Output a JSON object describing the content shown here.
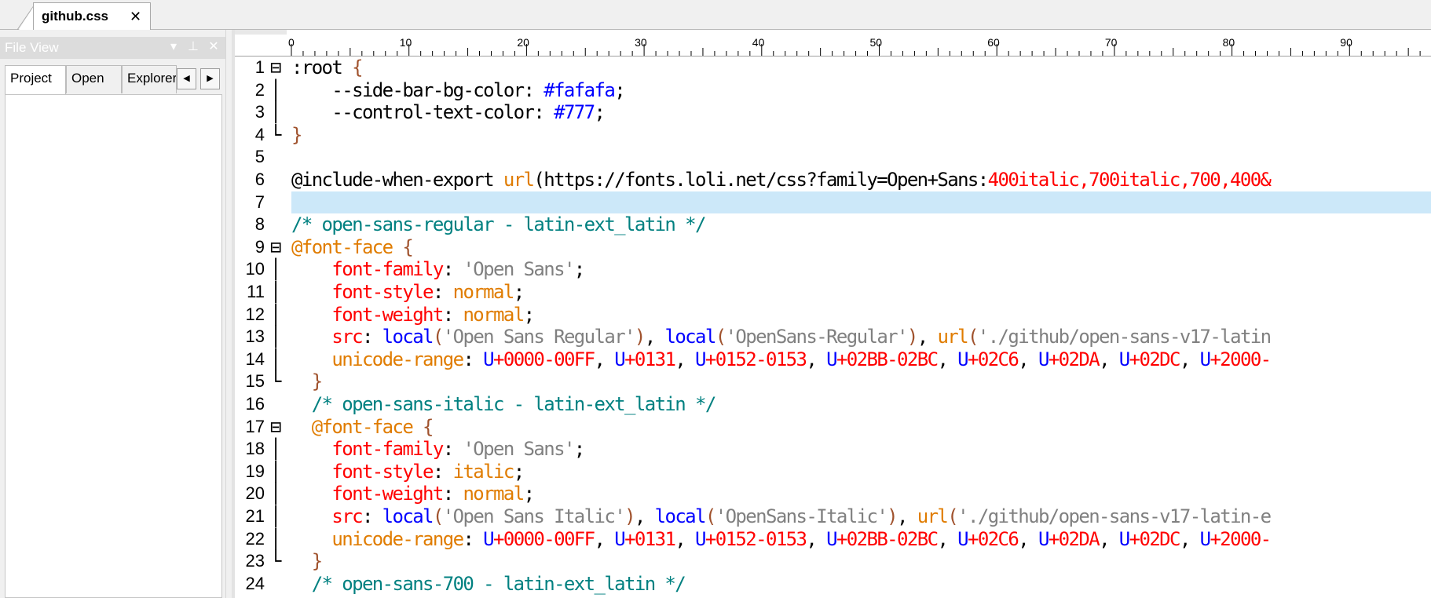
{
  "tab": {
    "title": "github.css",
    "close": "✕"
  },
  "fileview": {
    "title": "File View",
    "buttons": {
      "dropdown": "▾",
      "pin": "⊥",
      "close": "✕"
    },
    "tabs": [
      {
        "label": "Project"
      },
      {
        "label": "Open"
      },
      {
        "label": "Explorer"
      }
    ],
    "arrows": {
      "left": "◀",
      "right": "▶"
    }
  },
  "ruler": {
    "labels": [
      "0",
      "10",
      "20",
      "30",
      "40",
      "50",
      "60",
      "70",
      "80",
      "90"
    ]
  },
  "editor": {
    "current_line": 7,
    "lines": [
      {
        "n": "1",
        "fold": "⊟",
        "tokens": [
          [
            "t-plain",
            ":root "
          ],
          [
            "t-brace",
            "{"
          ]
        ]
      },
      {
        "n": "2",
        "fold": "│",
        "tokens": [
          [
            "t-var",
            "    --side-bar-bg-color: "
          ],
          [
            "t-blue",
            "#fafafa"
          ],
          [
            "t-plain",
            ";"
          ]
        ]
      },
      {
        "n": "3",
        "fold": "│",
        "tokens": [
          [
            "t-var",
            "    --control-text-color: "
          ],
          [
            "t-blue",
            "#777"
          ],
          [
            "t-plain",
            ";"
          ]
        ]
      },
      {
        "n": "4",
        "fold": "└",
        "tokens": [
          [
            "t-brace",
            "}"
          ]
        ]
      },
      {
        "n": "5",
        "fold": "",
        "tokens": []
      },
      {
        "n": "6",
        "fold": "",
        "tokens": [
          [
            "t-plain",
            "@include-when-export "
          ],
          [
            "t-orange",
            "url"
          ],
          [
            "t-plain",
            "(https://fonts.loli.net/css?family=Open+Sans:"
          ],
          [
            "t-red",
            "400italic,700italic,700,400&"
          ]
        ]
      },
      {
        "n": "7",
        "fold": "",
        "tokens": []
      },
      {
        "n": "8",
        "fold": "",
        "tokens": [
          [
            "t-comment",
            "/* open-sans-regular - latin-ext_latin */"
          ]
        ]
      },
      {
        "n": "9",
        "fold": "⊟",
        "tokens": [
          [
            "t-orange",
            "@font-face "
          ],
          [
            "t-brace",
            "{"
          ]
        ]
      },
      {
        "n": "10",
        "fold": "│",
        "tokens": [
          [
            "t-red",
            "    font-family"
          ],
          [
            "t-plain",
            ": "
          ],
          [
            "t-gray",
            "'Open Sans'"
          ],
          [
            "t-plain",
            ";"
          ]
        ]
      },
      {
        "n": "11",
        "fold": "│",
        "tokens": [
          [
            "t-red",
            "    font-style"
          ],
          [
            "t-plain",
            ": "
          ],
          [
            "t-orange",
            "normal"
          ],
          [
            "t-plain",
            ";"
          ]
        ]
      },
      {
        "n": "12",
        "fold": "│",
        "tokens": [
          [
            "t-red",
            "    font-weight"
          ],
          [
            "t-plain",
            ": "
          ],
          [
            "t-orange",
            "normal"
          ],
          [
            "t-plain",
            ";"
          ]
        ]
      },
      {
        "n": "13",
        "fold": "│",
        "tokens": [
          [
            "t-red",
            "    src"
          ],
          [
            "t-plain",
            ": "
          ],
          [
            "t-blue",
            "local"
          ],
          [
            "t-pun",
            "("
          ],
          [
            "t-gray",
            "'Open Sans Regular'"
          ],
          [
            "t-pun",
            ")"
          ],
          [
            "t-plain",
            ", "
          ],
          [
            "t-blue",
            "local"
          ],
          [
            "t-pun",
            "("
          ],
          [
            "t-gray",
            "'OpenSans-Regular'"
          ],
          [
            "t-pun",
            ")"
          ],
          [
            "t-plain",
            ", "
          ],
          [
            "t-orange",
            "url"
          ],
          [
            "t-pun",
            "("
          ],
          [
            "t-gray",
            "'./github/open-sans-v17-latin"
          ]
        ]
      },
      {
        "n": "14",
        "fold": "│",
        "tokens": [
          [
            "t-orange",
            "    unicode-range"
          ],
          [
            "t-plain",
            ": "
          ],
          [
            "t-blue",
            "U"
          ],
          [
            "t-red",
            "+0000-00FF"
          ],
          [
            "t-plain",
            ", "
          ],
          [
            "t-blue",
            "U"
          ],
          [
            "t-red",
            "+0131"
          ],
          [
            "t-plain",
            ", "
          ],
          [
            "t-blue",
            "U"
          ],
          [
            "t-red",
            "+0152-0153"
          ],
          [
            "t-plain",
            ", "
          ],
          [
            "t-blue",
            "U"
          ],
          [
            "t-red",
            "+02BB-02BC"
          ],
          [
            "t-plain",
            ", "
          ],
          [
            "t-blue",
            "U"
          ],
          [
            "t-red",
            "+02C6"
          ],
          [
            "t-plain",
            ", "
          ],
          [
            "t-blue",
            "U"
          ],
          [
            "t-red",
            "+02DA"
          ],
          [
            "t-plain",
            ", "
          ],
          [
            "t-blue",
            "U"
          ],
          [
            "t-red",
            "+02DC"
          ],
          [
            "t-plain",
            ", "
          ],
          [
            "t-blue",
            "U"
          ],
          [
            "t-red",
            "+2000-"
          ]
        ]
      },
      {
        "n": "15",
        "fold": "└",
        "tokens": [
          [
            "t-brace",
            "  }"
          ]
        ]
      },
      {
        "n": "16",
        "fold": "",
        "tokens": [
          [
            "t-comment",
            "  /* open-sans-italic - latin-ext_latin */"
          ]
        ]
      },
      {
        "n": "17",
        "fold": "⊟",
        "tokens": [
          [
            "t-orange",
            "  @font-face "
          ],
          [
            "t-brace",
            "{"
          ]
        ]
      },
      {
        "n": "18",
        "fold": "│",
        "tokens": [
          [
            "t-red",
            "    font-family"
          ],
          [
            "t-plain",
            ": "
          ],
          [
            "t-gray",
            "'Open Sans'"
          ],
          [
            "t-plain",
            ";"
          ]
        ]
      },
      {
        "n": "19",
        "fold": "│",
        "tokens": [
          [
            "t-red",
            "    font-style"
          ],
          [
            "t-plain",
            ": "
          ],
          [
            "t-orange",
            "italic"
          ],
          [
            "t-plain",
            ";"
          ]
        ]
      },
      {
        "n": "20",
        "fold": "│",
        "tokens": [
          [
            "t-red",
            "    font-weight"
          ],
          [
            "t-plain",
            ": "
          ],
          [
            "t-orange",
            "normal"
          ],
          [
            "t-plain",
            ";"
          ]
        ]
      },
      {
        "n": "21",
        "fold": "│",
        "tokens": [
          [
            "t-red",
            "    src"
          ],
          [
            "t-plain",
            ": "
          ],
          [
            "t-blue",
            "local"
          ],
          [
            "t-pun",
            "("
          ],
          [
            "t-gray",
            "'Open Sans Italic'"
          ],
          [
            "t-pun",
            ")"
          ],
          [
            "t-plain",
            ", "
          ],
          [
            "t-blue",
            "local"
          ],
          [
            "t-pun",
            "("
          ],
          [
            "t-gray",
            "'OpenSans-Italic'"
          ],
          [
            "t-pun",
            ")"
          ],
          [
            "t-plain",
            ", "
          ],
          [
            "t-orange",
            "url"
          ],
          [
            "t-pun",
            "("
          ],
          [
            "t-gray",
            "'./github/open-sans-v17-latin-e"
          ]
        ]
      },
      {
        "n": "22",
        "fold": "│",
        "tokens": [
          [
            "t-orange",
            "    unicode-range"
          ],
          [
            "t-plain",
            ": "
          ],
          [
            "t-blue",
            "U"
          ],
          [
            "t-red",
            "+0000-00FF"
          ],
          [
            "t-plain",
            ", "
          ],
          [
            "t-blue",
            "U"
          ],
          [
            "t-red",
            "+0131"
          ],
          [
            "t-plain",
            ", "
          ],
          [
            "t-blue",
            "U"
          ],
          [
            "t-red",
            "+0152-0153"
          ],
          [
            "t-plain",
            ", "
          ],
          [
            "t-blue",
            "U"
          ],
          [
            "t-red",
            "+02BB-02BC"
          ],
          [
            "t-plain",
            ", "
          ],
          [
            "t-blue",
            "U"
          ],
          [
            "t-red",
            "+02C6"
          ],
          [
            "t-plain",
            ", "
          ],
          [
            "t-blue",
            "U"
          ],
          [
            "t-red",
            "+02DA"
          ],
          [
            "t-plain",
            ", "
          ],
          [
            "t-blue",
            "U"
          ],
          [
            "t-red",
            "+02DC"
          ],
          [
            "t-plain",
            ", "
          ],
          [
            "t-blue",
            "U"
          ],
          [
            "t-red",
            "+2000-"
          ]
        ]
      },
      {
        "n": "23",
        "fold": "└",
        "tokens": [
          [
            "t-brace",
            "  }"
          ]
        ]
      },
      {
        "n": "24",
        "fold": "",
        "tokens": [
          [
            "t-comment",
            "  /* open-sans-700 - latin-ext_latin */"
          ]
        ]
      }
    ]
  },
  "colors": {
    "highlight": "#cce8f9",
    "comment": "#008080",
    "keyword": "#ff0000",
    "value": "#e07c00",
    "blue": "#0000ff"
  }
}
